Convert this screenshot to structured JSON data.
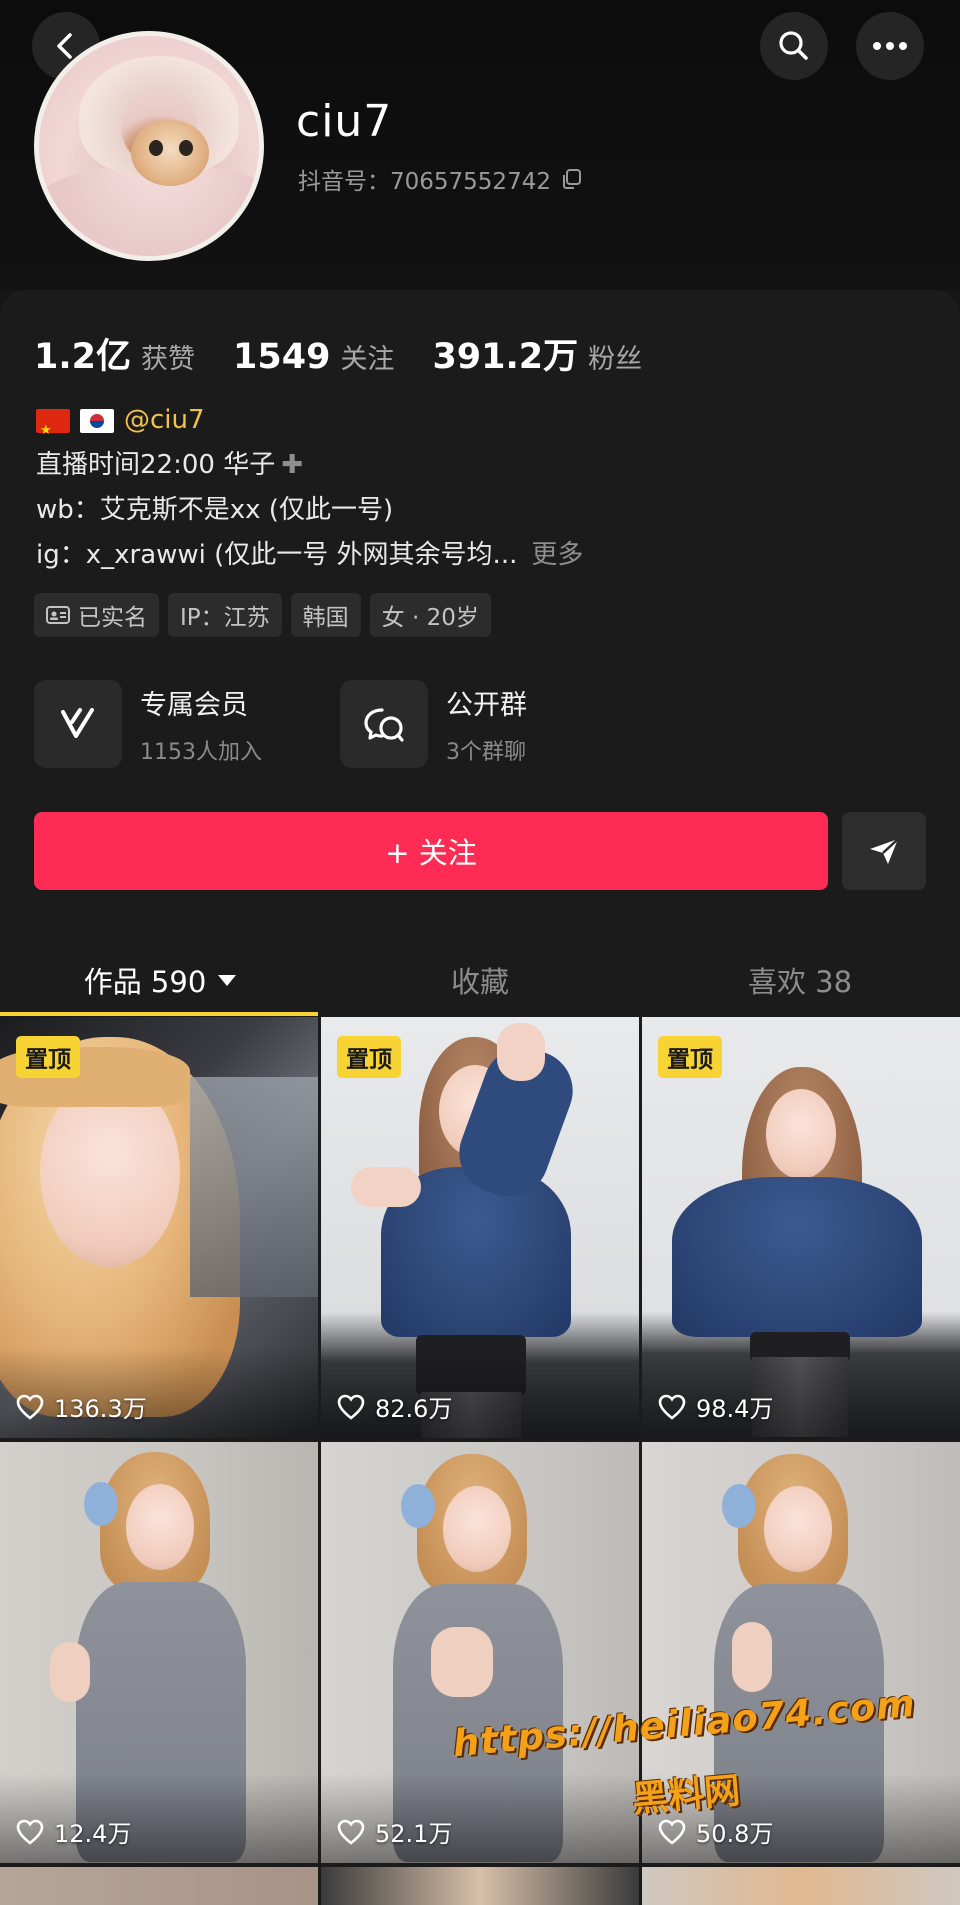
{
  "header": {
    "username": "ciu7",
    "douyin_id": "抖音号：70657552742"
  },
  "stats": [
    {
      "value": "1.2亿",
      "label": "获赞"
    },
    {
      "value": "1549",
      "label": "关注"
    },
    {
      "value": "391.2万",
      "label": "粉丝"
    }
  ],
  "bio": {
    "mention": "@ciu7",
    "line2": "直播时间22:00 华子",
    "line3": "wb：艾克斯不是xx (仅此一号)",
    "line4": "ig：x_xrawwi (仅此一号 外网其余号均...",
    "more": "更多"
  },
  "tags": [
    "已实名",
    "IP：江苏",
    "韩国",
    "女 · 20岁"
  ],
  "features": [
    {
      "title": "专属会员",
      "subtitle": "1153人加入",
      "icon": "v-icon"
    },
    {
      "title": "公开群",
      "subtitle": "3个群聊",
      "icon": "group-chat-icon"
    }
  ],
  "follow_label": "+ 关注",
  "tabs": [
    {
      "label": "作品 590"
    },
    {
      "label": "收藏"
    },
    {
      "label": "喜欢 38"
    }
  ],
  "videos": [
    {
      "pinned": "置顶",
      "likes": "136.3万"
    },
    {
      "pinned": "置顶",
      "likes": "82.6万"
    },
    {
      "pinned": "置顶",
      "likes": "98.4万"
    },
    {
      "pinned": "",
      "likes": "12.4万"
    },
    {
      "pinned": "",
      "likes": "52.1万"
    },
    {
      "pinned": "",
      "likes": "50.8万"
    }
  ],
  "watermark": {
    "url": "https://heiliao74.com",
    "name": "黑料网"
  },
  "colors": {
    "accent": "#fe2c55",
    "pin": "#f7d433",
    "mention": "#f0c24b",
    "background": "#161616"
  }
}
